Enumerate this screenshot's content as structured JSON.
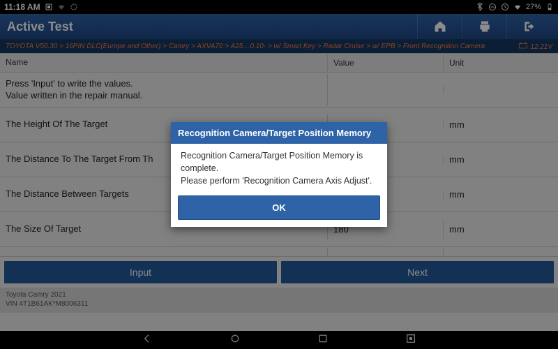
{
  "status": {
    "time": "11:18 AM",
    "battery_pct": "27%"
  },
  "header": {
    "title": "Active Test"
  },
  "breadcrumb": {
    "path": "TOYOTA V50.30 > 16PIN DLC(Europe and Other) > Camry > AXVA70 > A25…0.10- > w/ Smart Key > Radar Cruise > w/ EPB > Front Recognition Camera",
    "voltage": "12.21V"
  },
  "columns": {
    "name": "Name",
    "value": "Value",
    "unit": "Unit"
  },
  "rows": [
    {
      "name": "Press 'Input' to write the values.\nValue written in the repair manual.",
      "value": "",
      "unit": ""
    },
    {
      "name": "The Height Of The Target",
      "value": "",
      "unit": "mm"
    },
    {
      "name": "The Distance To The Target From Th",
      "value": "",
      "unit": "mm"
    },
    {
      "name": "The Distance Between Targets",
      "value": "",
      "unit": "mm"
    },
    {
      "name": "The Size Of Target",
      "value": "180",
      "unit": "mm"
    }
  ],
  "buttons": {
    "input": "Input",
    "next": "Next"
  },
  "footer": {
    "vehicle": "Toyota Camry 2021",
    "vin": "VIN 4T1B61AK*M8006311"
  },
  "dialog": {
    "title": "Recognition Camera/Target Position Memory",
    "line1": "Recognition Camera/Target Position Memory is complete.",
    "line2": "Please perform 'Recognition Camera Axis Adjust'.",
    "ok": "OK"
  }
}
